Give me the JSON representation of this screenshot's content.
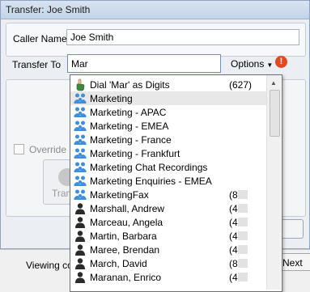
{
  "window": {
    "title": "Transfer: Joe Smith"
  },
  "caller": {
    "label": "Caller Name",
    "value": "Joe Smith"
  },
  "transfer": {
    "label": "Transfer To",
    "value": "Mar",
    "options_label": "Options",
    "warning_icon": "warning-icon"
  },
  "override": {
    "label": "Override"
  },
  "transfer_button": {
    "label": "Tran"
  },
  "statusbar": {
    "viewing_text": "Viewing co",
    "next_label": "Next"
  },
  "dropdown": {
    "items": [
      {
        "name": "Dial 'Mar' as Digits",
        "ext": "(627)",
        "icon": "hand-pointer-icon",
        "selected": false
      },
      {
        "name": "Marketing",
        "ext": "",
        "icon": "group-icon",
        "selected": true
      },
      {
        "name": "Marketing - APAC",
        "ext": "",
        "icon": "group-icon",
        "selected": false
      },
      {
        "name": "Marketing - EMEA",
        "ext": "",
        "icon": "group-icon",
        "selected": false
      },
      {
        "name": "Marketing - France",
        "ext": "",
        "icon": "group-icon",
        "selected": false
      },
      {
        "name": "Marketing - Frankfurt",
        "ext": "",
        "icon": "group-icon",
        "selected": false
      },
      {
        "name": "Marketing Chat Recordings",
        "ext": "",
        "icon": "group-icon",
        "selected": false
      },
      {
        "name": "Marketing Enquiries - EMEA",
        "ext": "",
        "icon": "group-icon",
        "selected": false
      },
      {
        "name": "MarketingFax",
        "ext": "(8",
        "icon": "group-icon",
        "selected": false
      },
      {
        "name": "Marshall, Andrew",
        "ext": "(4",
        "icon": "person-icon",
        "selected": false
      },
      {
        "name": "Marceau, Angela",
        "ext": "(4",
        "icon": "person-icon",
        "selected": false
      },
      {
        "name": "Martin, Barbara",
        "ext": "(4",
        "icon": "person-icon",
        "selected": false
      },
      {
        "name": "Maree, Brendan",
        "ext": "(4",
        "icon": "person-icon",
        "selected": false
      },
      {
        "name": "March, David",
        "ext": "(8",
        "icon": "person-icon",
        "selected": false
      },
      {
        "name": "Maranan, Enrico",
        "ext": "(4",
        "icon": "person-icon",
        "selected": false
      }
    ]
  },
  "colors": {
    "group_icon": "#3d8fe0",
    "person_icon": "#2b2b2b",
    "warning": "#e24a1d"
  }
}
